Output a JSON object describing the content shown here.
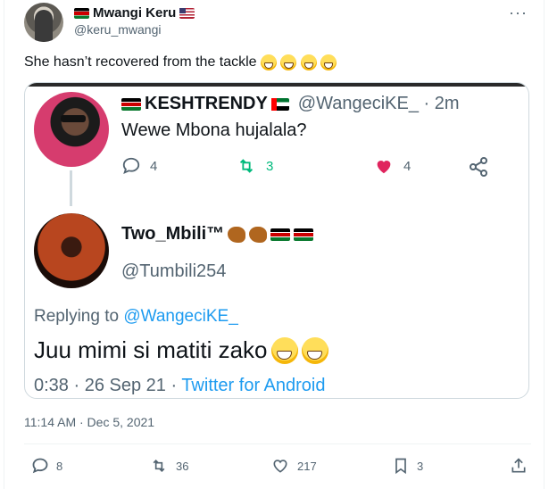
{
  "author": {
    "display_name": "Mwangi Keru",
    "handle": "@keru_mwangi"
  },
  "tweet": {
    "text": "She hasn’t recovered from the tackle",
    "emoji_count": 4,
    "timestamp": "11:14 AM · Dec 5, 2021",
    "stats": {
      "replies": "8",
      "retweets": "36",
      "likes": "217",
      "bookmarks": "3"
    }
  },
  "embedded": {
    "post1": {
      "display_name": "KESHTRENDY",
      "handle_time": "@WangeciKE_ · 2m",
      "text": "Wewe Mbona hujalala?",
      "replies": "4",
      "retweets": "3",
      "likes": "4",
      "like_color": "#e0245e"
    },
    "post2": {
      "display_name": "Two_Mbili™",
      "handle": "@Tumbili254",
      "replying_prefix": "Replying to ",
      "replying_to": "@WangeciKE_",
      "text": "Juu mimi si matiti zako",
      "meta_time": "0:38 · 26 Sep 21 · ",
      "meta_via": "Twitter for Android"
    }
  },
  "colors": {
    "accent": "#1d9bf0",
    "muted": "#536471",
    "text": "#0f1419"
  }
}
